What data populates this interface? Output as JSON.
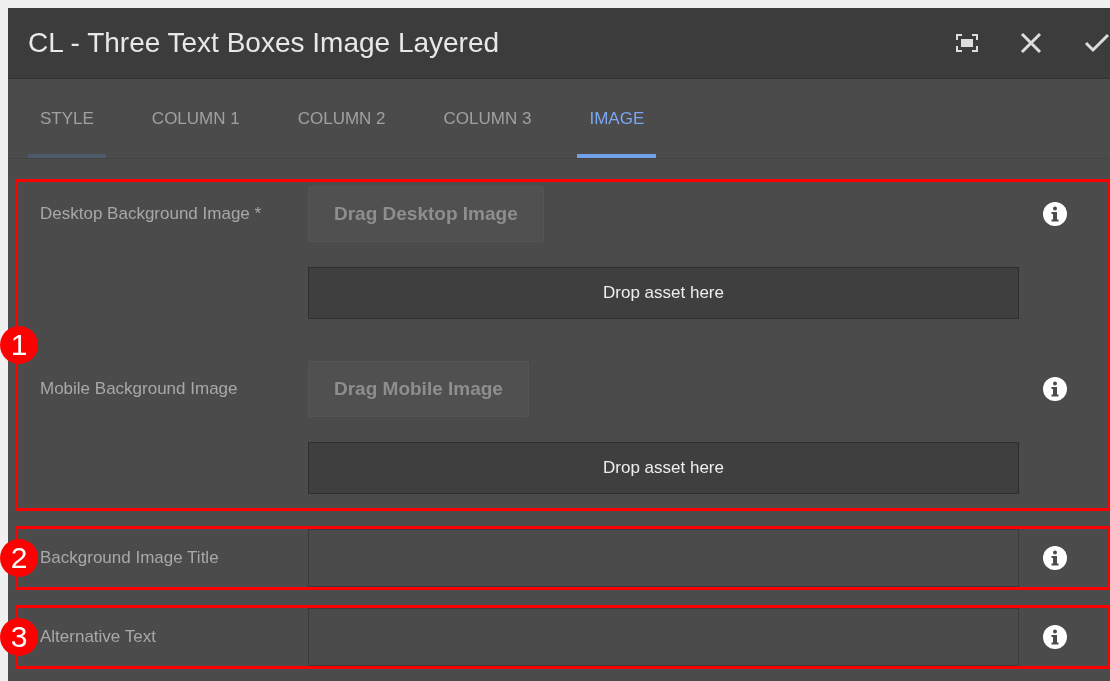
{
  "dialog": {
    "title": "CL - Three Text Boxes Image Layered"
  },
  "tabs": [
    {
      "label": "STYLE",
      "selected": false,
      "focused": true
    },
    {
      "label": "COLUMN 1",
      "selected": false,
      "focused": false
    },
    {
      "label": "COLUMN 2",
      "selected": false,
      "focused": false
    },
    {
      "label": "COLUMN 3",
      "selected": false,
      "focused": false
    },
    {
      "label": "IMAGE",
      "selected": true,
      "focused": false
    }
  ],
  "sections": [
    {
      "marker": "1",
      "fields": [
        {
          "kind": "asset",
          "label": "Desktop Background Image *",
          "button": "Drag Desktop Image",
          "drop_zone": "Drop asset here"
        },
        {
          "kind": "asset",
          "label": "Mobile Background Image",
          "button": "Drag Mobile Image",
          "drop_zone": "Drop asset here"
        }
      ]
    },
    {
      "marker": "2",
      "fields": [
        {
          "kind": "text",
          "label": "Background Image Title"
        }
      ]
    },
    {
      "marker": "3",
      "fields": [
        {
          "kind": "text",
          "label": "Alternative Text"
        }
      ]
    }
  ]
}
